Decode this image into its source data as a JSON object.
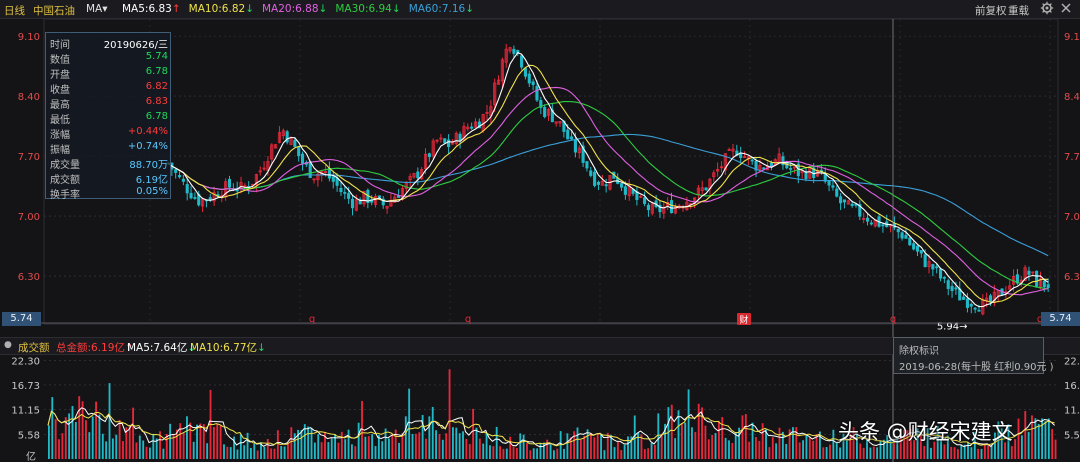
{
  "toolbar": {
    "period": "日线",
    "stock_name": "中国石油",
    "indicator": "MA",
    "indicator_arrow": "▾",
    "ma_items": [
      {
        "label": "MA5:6.83",
        "arrow": "↑",
        "color": "#ffffff",
        "arrow_color": "#ff3b3b"
      },
      {
        "label": "MA10:6.82",
        "arrow": "↓",
        "color": "#f0e24a",
        "arrow_color": "#1fd95a"
      },
      {
        "label": "MA20:6.88",
        "arrow": "↓",
        "color": "#e060e0",
        "arrow_color": "#1fd95a"
      },
      {
        "label": "MA30:6.94",
        "arrow": "↓",
        "color": "#2ecc40",
        "arrow_color": "#1fd95a"
      },
      {
        "label": "MA60:7.16",
        "arrow": "↓",
        "color": "#3aa0d8",
        "arrow_color": "#1fd95a"
      }
    ],
    "right_items": [
      "前复权",
      "重载"
    ],
    "icons": [
      "gear-icon",
      "close-icon"
    ]
  },
  "info_panel": {
    "rows": [
      {
        "key": "时间",
        "value": "20190626/三",
        "color": "#ffffff"
      },
      {
        "key": "数值",
        "value": "5.74",
        "color": "#1fd95a"
      },
      {
        "key": "开盘",
        "value": "6.78",
        "color": "#1fd95a"
      },
      {
        "key": "收盘",
        "value": "6.82",
        "color": "#ff3b3b"
      },
      {
        "key": "最高",
        "value": "6.83",
        "color": "#ff3b3b"
      },
      {
        "key": "最低",
        "value": "6.78",
        "color": "#1fd95a"
      },
      {
        "key": "涨幅",
        "value": "+0.44%",
        "color": "#ff3b3b"
      },
      {
        "key": "振幅",
        "value": "+0.74%",
        "color": "#5bc8ff"
      },
      {
        "key": "成交量",
        "value": "88.70万",
        "color": "#5bc8ff"
      },
      {
        "key": "成交额",
        "value": "6.19亿",
        "color": "#5bc8ff"
      },
      {
        "key": "换手率",
        "value": "0.05%",
        "color": "#5bc8ff"
      }
    ]
  },
  "volume_bar": {
    "collapse_icon": "●",
    "label": "成交额",
    "total": "总金额:6.19亿",
    "total_arrow": "↑",
    "ma5": "MA5:7.64亿",
    "ma5_arrow": "↓",
    "ma10": "MA10:6.77亿",
    "ma10_arrow": "↓"
  },
  "tooltip": {
    "title": "除权标识",
    "text": "2019-06-28(每十股 红利0.90元 )"
  },
  "markers": {
    "low_label": "5.94→",
    "cursor_price": "5.74",
    "ex_right_glyph": "q",
    "finance_glyph": "财",
    "volume_unit": "亿",
    "corner_icon": "triangle-icon"
  },
  "watermark": "头条 @财经宋建文",
  "colors": {
    "up": "#e8283a",
    "down": "#21b9c7",
    "ma5": "#ffffff",
    "ma10": "#f0e24a",
    "ma20": "#e060e0",
    "ma30": "#2ecc40",
    "ma60": "#3aa0d8",
    "axis_text": "#e34b4b",
    "grid": "#3a3a44",
    "background": "#141417"
  },
  "chart_data": [
    {
      "type": "candlestick",
      "title": "中国石油",
      "y_ticks": [
        9.1,
        8.4,
        7.7,
        7.0,
        6.3
      ],
      "y_tick_labels": [
        "9.10",
        "8.40",
        "7.70",
        "7.00",
        "6.30"
      ],
      "ylim": [
        5.74,
        9.3
      ],
      "grid": true,
      "annotations": [
        "5.94→",
        "q",
        "财"
      ],
      "series": [
        {
          "name": "MA5",
          "last": 6.83
        },
        {
          "name": "MA10",
          "last": 6.82
        },
        {
          "name": "MA20",
          "last": 6.88
        },
        {
          "name": "MA30",
          "last": 6.94
        },
        {
          "name": "MA60",
          "last": 7.16
        }
      ],
      "close_path": [
        7.62,
        7.45,
        7.3,
        7.18,
        7.22,
        7.3,
        7.35,
        7.32,
        7.38,
        7.55,
        7.8,
        8.02,
        7.85,
        7.62,
        7.48,
        7.52,
        7.4,
        7.25,
        7.15,
        7.22,
        7.18,
        7.12,
        7.25,
        7.35,
        7.48,
        7.68,
        7.88,
        7.82,
        7.92,
        8.05,
        8.1,
        8.25,
        8.7,
        9.05,
        8.85,
        8.55,
        8.25,
        8.18,
        8.05,
        7.82,
        7.7,
        7.45,
        7.38,
        7.48,
        7.35,
        7.22,
        7.12,
        7.05,
        7.1,
        7.12,
        7.18,
        7.25,
        7.35,
        7.52,
        7.68,
        7.78,
        7.66,
        7.58,
        7.6,
        7.65,
        7.55,
        7.5,
        7.52,
        7.48,
        7.3,
        7.15,
        7.08,
        7.02,
        6.95,
        6.9,
        6.85,
        6.78,
        6.62,
        6.48,
        6.38,
        6.22,
        6.1,
        6.02,
        5.98,
        5.96,
        6.05,
        6.18,
        6.28,
        6.35,
        6.22,
        6.2
      ]
    },
    {
      "type": "bar",
      "title": "成交额",
      "y_ticks": [
        22.3,
        16.73,
        11.15,
        5.58
      ],
      "y_tick_labels": [
        "22.30",
        "16.73",
        "11.15",
        "5.58"
      ],
      "unit": "亿",
      "ylim": [
        0,
        23.5
      ],
      "last": {
        "total": 6.19,
        "ma5": 7.64,
        "ma10": 6.77
      },
      "series": [
        {
          "name": "MA5",
          "last": 7.64
        },
        {
          "name": "MA10",
          "last": 6.77
        }
      ],
      "volume_path": [
        5.2,
        7.8,
        9.5,
        10.6,
        9.8,
        8.2,
        6.5,
        5.0,
        4.2,
        4.6,
        5.4,
        6.2,
        7.4,
        6.5,
        5.8,
        4.9,
        4.5,
        4.1,
        3.8,
        4.3,
        4.7,
        5.0,
        5.6,
        5.2,
        4.8,
        5.4,
        6.1,
        5.8,
        5.5,
        5.9,
        6.4,
        7.0,
        8.2,
        7.6,
        6.8,
        6.2,
        5.6,
        5.2,
        4.8,
        4.5,
        4.3,
        4.0,
        3.9,
        4.2,
        4.6,
        5.0,
        4.8,
        4.4,
        4.1,
        4.0,
        4.3,
        5.2,
        9.8,
        8.4,
        7.6,
        8.8,
        7.2,
        6.5,
        7.1,
        6.8,
        6.2,
        5.9,
        5.4,
        5.1,
        4.9,
        5.2,
        5.6,
        5.3,
        4.8,
        4.5,
        4.3,
        4.6,
        5.0,
        5.4,
        5.8,
        5.2,
        4.7,
        4.4,
        4.2,
        4.8,
        5.6,
        6.1,
        7.0,
        7.64,
        7.1,
        6.77
      ]
    }
  ]
}
